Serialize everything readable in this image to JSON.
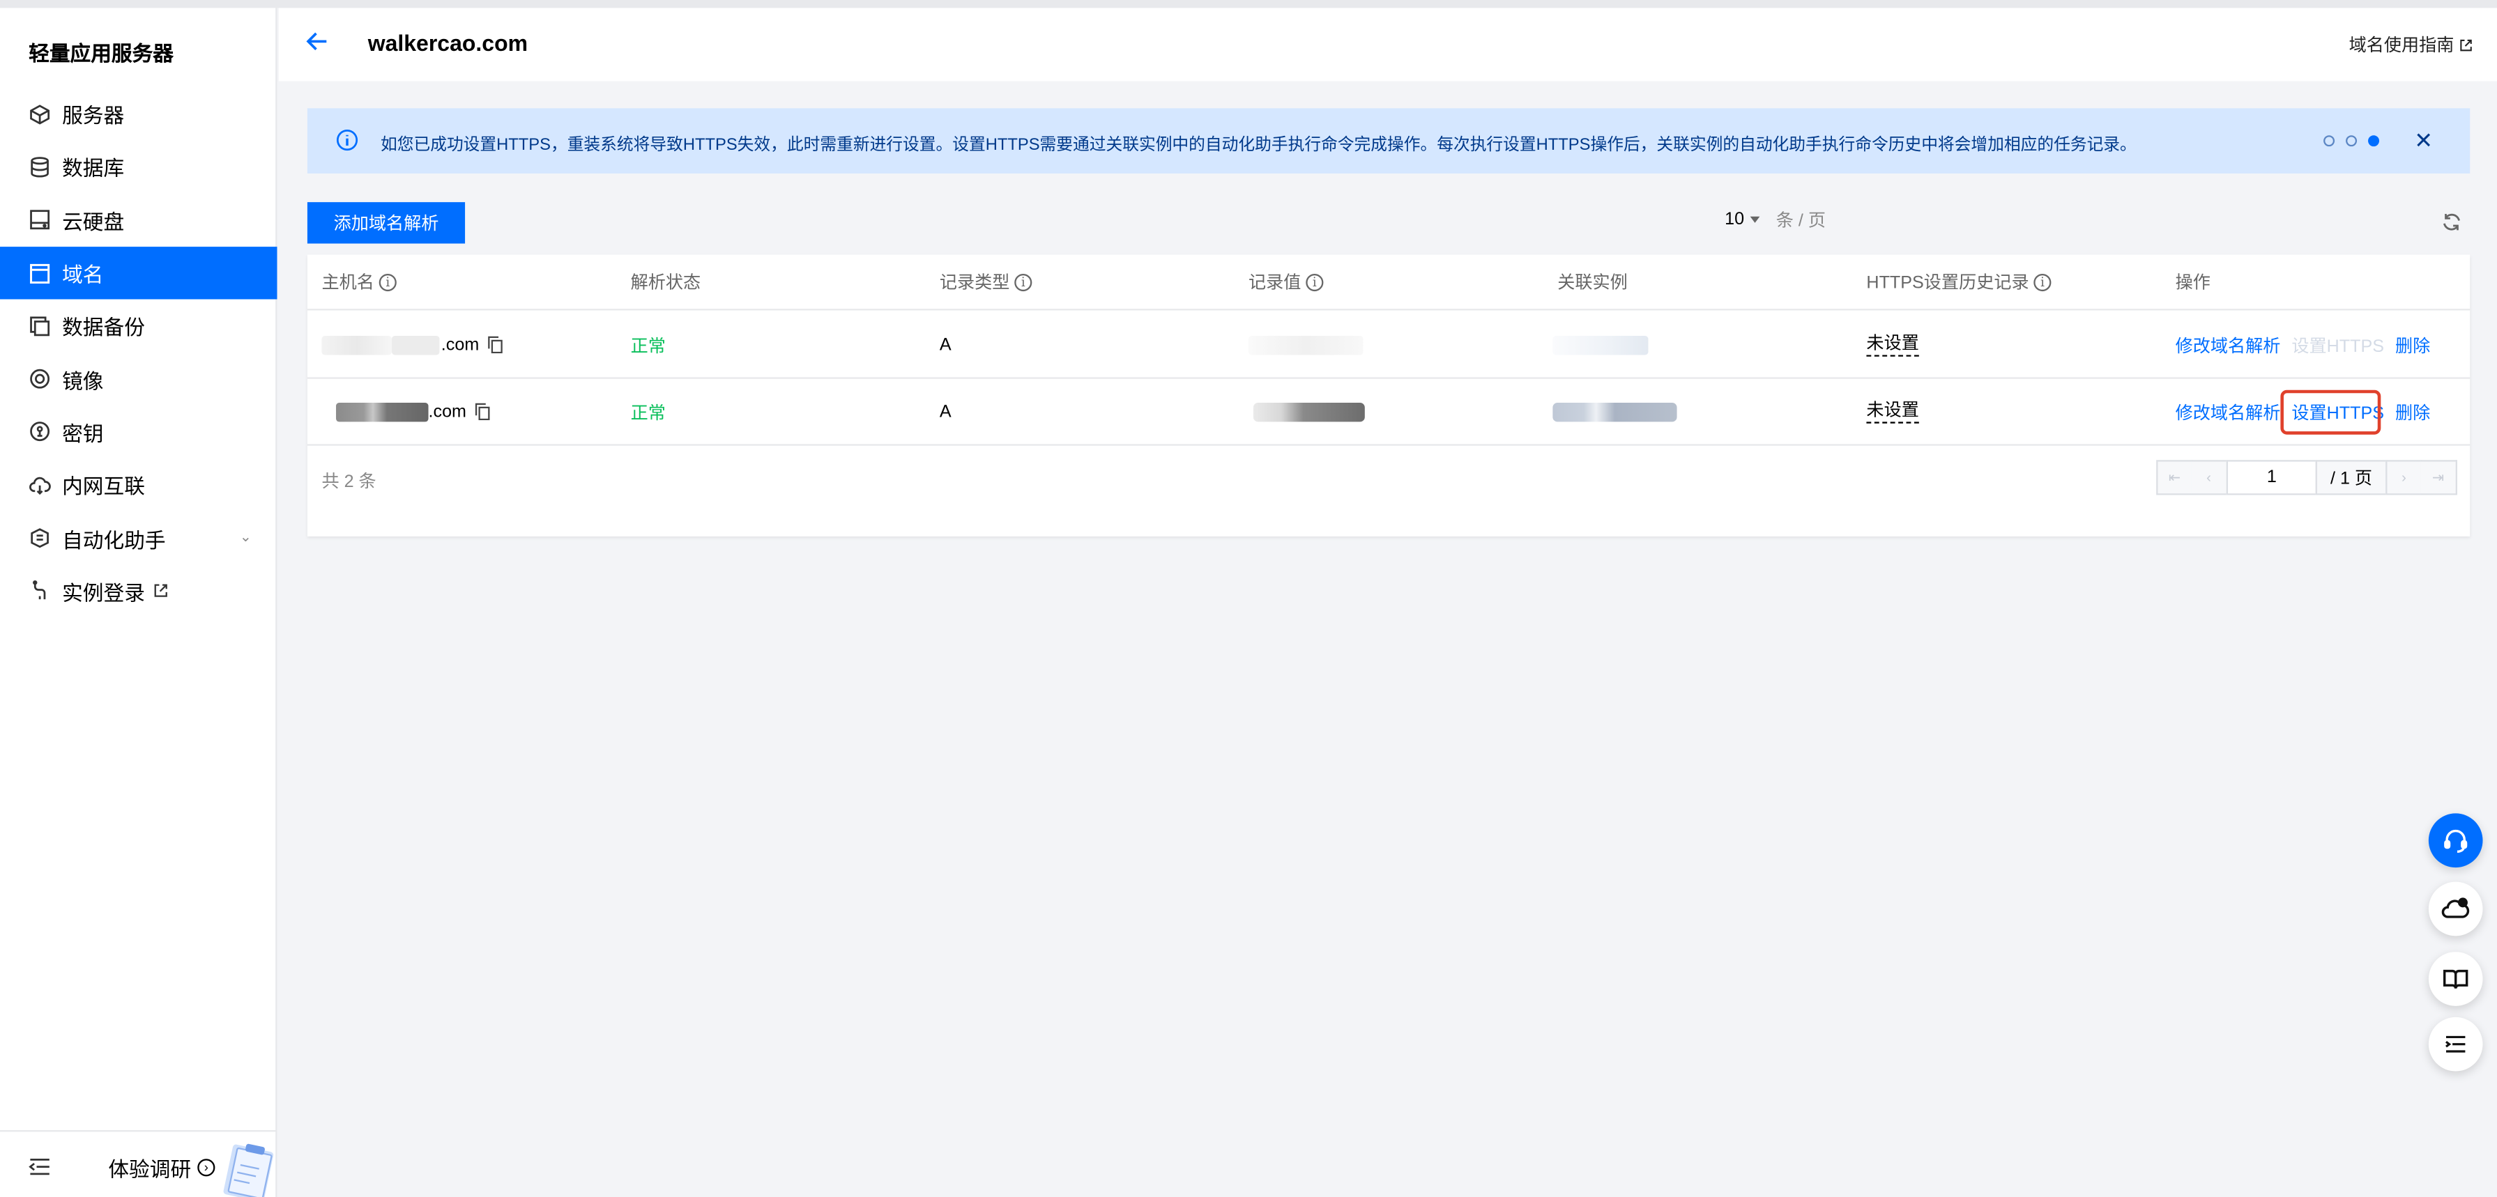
{
  "sidebar": {
    "brand": "轻量应用服务器",
    "items": [
      {
        "label": "服务器",
        "icon": "cube-icon"
      },
      {
        "label": "数据库",
        "icon": "database-icon"
      },
      {
        "label": "云硬盘",
        "icon": "disk-icon"
      },
      {
        "label": "域名",
        "icon": "domain-icon",
        "active": true
      },
      {
        "label": "数据备份",
        "icon": "backup-icon"
      },
      {
        "label": "镜像",
        "icon": "image-icon"
      },
      {
        "label": "密钥",
        "icon": "key-icon"
      },
      {
        "label": "内网互联",
        "icon": "cloud-link-icon"
      },
      {
        "label": "自动化助手",
        "icon": "automation-icon",
        "expandable": true
      },
      {
        "label": "实例登录",
        "icon": "terminal-icon",
        "external": true
      }
    ],
    "footer": {
      "survey_label": "体验调研"
    }
  },
  "header": {
    "title": "walkercao.com",
    "guide_link": "域名使用指南"
  },
  "alert": {
    "message": "如您已成功设置HTTPS，重装系统将导致HTTPS失效，此时需重新进行设置。设置HTTPS需要通过关联实例中的自动化助手执行命令完成操作。每次执行设置HTTPS操作后，关联实例的自动化助手执行命令历史中将会增加相应的任务记录。",
    "pages": 3,
    "current_page": 3
  },
  "toolbar": {
    "add_button": "添加域名解析"
  },
  "table": {
    "columns": [
      "主机名",
      "解析状态",
      "记录类型",
      "记录值",
      "关联实例",
      "HTTPS设置历史记录",
      "操作"
    ],
    "rows": [
      {
        "host": ".com",
        "status": "正常",
        "type": "A",
        "https_history": "未设置",
        "actions": [
          "修改域名解析",
          "设置HTTPS",
          "删除"
        ],
        "https_enabled": false
      },
      {
        "host": ".com",
        "status": "正常",
        "type": "A",
        "https_history": "未设置",
        "actions": [
          "修改域名解析",
          "设置HTTPS",
          "删除"
        ],
        "https_enabled": true
      }
    ],
    "total": "共 2 条",
    "pager": {
      "page_size": "10",
      "per_page_label": "条 / 页",
      "page_input": "1",
      "page_total": "/ 1 页"
    }
  },
  "colors": {
    "accent": "#006eff",
    "ok": "#0abf5b",
    "highlight": "#e0412c",
    "alert_bg": "#d5e7ff"
  }
}
